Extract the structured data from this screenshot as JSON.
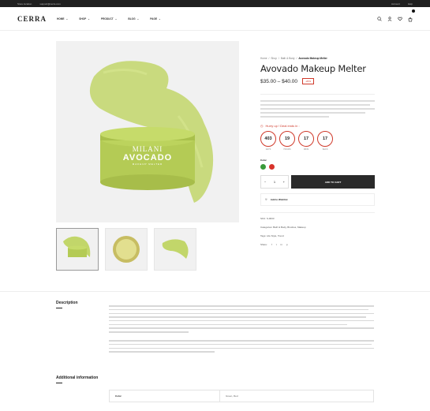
{
  "topbar": {
    "store_location": "Store location",
    "email": "support@cerra.com",
    "account": "Account",
    "help": "Help"
  },
  "header": {
    "logo": "CERRA",
    "nav": [
      "HOME",
      "SHOP",
      "PRODUCT",
      "BLOG",
      "PAGE"
    ]
  },
  "breadcrumb": [
    "Home",
    "Shop",
    "Bath & Body",
    "Avovado Makeup Melter"
  ],
  "product": {
    "title": "Avovado Makeup Melter",
    "price": "$35.00 – $40.00",
    "save": "-20%",
    "hurry": "Hurry up ! Deal ends in :",
    "timer": [
      {
        "value": "403",
        "label": "DAYS"
      },
      {
        "value": "19",
        "label": "HOURS"
      },
      {
        "value": "17",
        "label": "MINS"
      },
      {
        "value": "17",
        "label": "SECS"
      }
    ],
    "color_label": "Color",
    "swatches": [
      "#3a9a3a",
      "#d8332b"
    ],
    "qty": "1",
    "minus": "−",
    "plus": "+",
    "add_to_cart": "ADD TO CART",
    "wishlist": "Add to Wishlist",
    "sku": "SKU: S-0033",
    "categories": "Categories: Bath & Body, Brushes, Makeup",
    "tags": "Tags: Life Style, Trend",
    "share": "Share:"
  },
  "jar": {
    "brand": "MILANI",
    "name": "AVOCADO",
    "sub": "MAKEUP MELTER"
  },
  "description": {
    "title": "Description"
  },
  "additional": {
    "title": "Additional information",
    "row_label": "Color",
    "row_value": "Green, Red"
  },
  "colors": {
    "accent": "#d03a2b",
    "dark": "#2a2a2a",
    "product_green": "#b8cf5a"
  }
}
